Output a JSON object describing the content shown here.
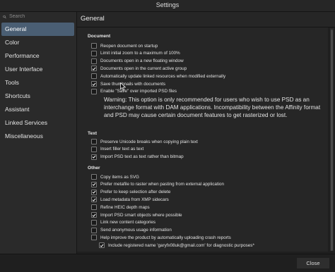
{
  "window": {
    "title": "Settings"
  },
  "search": {
    "placeholder": "Search"
  },
  "sidebar": {
    "items": [
      {
        "id": "general",
        "label": "General",
        "active": true
      },
      {
        "id": "color",
        "label": "Color"
      },
      {
        "id": "performance",
        "label": "Performance"
      },
      {
        "id": "user-interface",
        "label": "User Interface"
      },
      {
        "id": "tools",
        "label": "Tools"
      },
      {
        "id": "shortcuts",
        "label": "Shortcuts"
      },
      {
        "id": "assistant",
        "label": "Assistant"
      },
      {
        "id": "linked-services",
        "label": "Linked Services"
      },
      {
        "id": "miscellaneous",
        "label": "Miscellaneous"
      }
    ]
  },
  "header": {
    "title": "General"
  },
  "sections": {
    "document": {
      "title": "Document",
      "options": [
        {
          "label": "Reopen document on startup",
          "checked": false
        },
        {
          "label": "Limit initial zoom to a maximum of 100%",
          "checked": false
        },
        {
          "label": "Documents open in a new floating window",
          "checked": false
        },
        {
          "label": "Documents open in the current active group",
          "checked": true
        },
        {
          "label": "Automatically update linked resources when modified externally",
          "checked": false
        },
        {
          "label": "Save thumbnails with documents",
          "checked": true
        },
        {
          "label": "Enable \"Save\" over imported PSD files",
          "checked": false
        }
      ],
      "warning": "Warning: This option is only recommended for users who wish to use PSD as an interchange format with DAM applications. Incompatibility between the Affinity format and PSD may cause certain document features to get rasterized or lost."
    },
    "text": {
      "title": "Text",
      "options": [
        {
          "label": "Preserve Unicode breaks when copying plain text",
          "checked": false
        },
        {
          "label": "Insert filler text as text",
          "checked": false
        },
        {
          "label": "Import PSD text as text rather than bitmap",
          "checked": true
        }
      ]
    },
    "other": {
      "title": "Other",
      "options": [
        {
          "label": "Copy items as SVG",
          "checked": false
        },
        {
          "label": "Prefer metafile to raster when pasting from external application",
          "checked": true
        },
        {
          "label": "Prefer to keep selection after delete",
          "checked": true
        },
        {
          "label": "Load metadata from XMP sidecars",
          "checked": true
        },
        {
          "label": "Refine HEIC depth maps",
          "checked": false
        },
        {
          "label": "Import PSD smart objects where possible",
          "checked": true
        },
        {
          "label": "Link new content categories",
          "checked": false
        },
        {
          "label": "Send anonymous usage information",
          "checked": false
        },
        {
          "label": "Help improve the product by automatically uploading crash reports",
          "checked": false
        },
        {
          "label": "Include registered name 'garyfx08uk@gmail.com' for diagnostic purposes*",
          "checked": true,
          "indent": true
        }
      ]
    }
  },
  "footer": {
    "close_label": "Close"
  },
  "icons": {
    "search": "search-icon",
    "check": "check-icon",
    "cursor": "pointer-cursor-icon"
  },
  "colors": {
    "active_nav": "#4a5e73",
    "background": "#262626",
    "sidebar": "#2a2a2a"
  }
}
